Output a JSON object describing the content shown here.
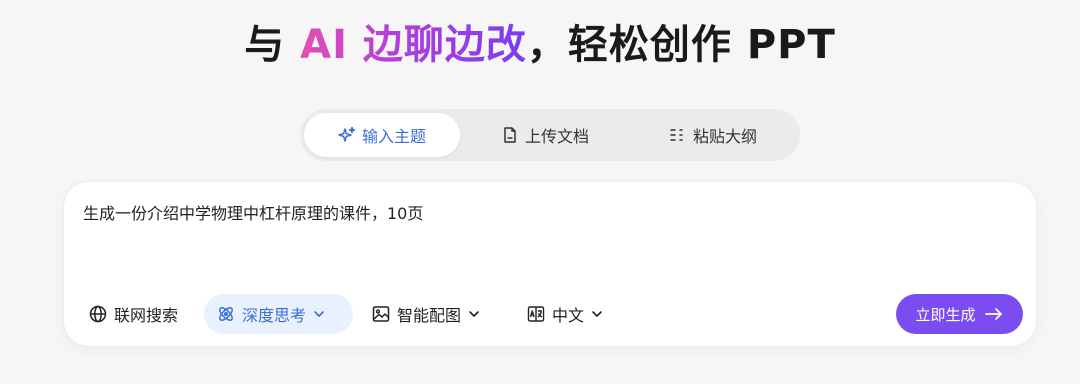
{
  "header": {
    "title_prefix": "与 ",
    "title_highlight": "AI 边聊边改",
    "title_suffix": "，轻松创作 PPT"
  },
  "mode_tabs": [
    {
      "label": "输入主题",
      "icon": "sparkle-icon",
      "active": true
    },
    {
      "label": "上传文档",
      "icon": "document-icon",
      "active": false
    },
    {
      "label": "粘贴大纲",
      "icon": "outline-list-icon",
      "active": false
    }
  ],
  "prompt": {
    "value": "生成一份介绍中学物理中杠杆原理的课件，10页"
  },
  "options": {
    "web_search": {
      "label": "联网搜索",
      "icon": "globe-icon"
    },
    "deep_think": {
      "label": "深度思考",
      "icon": "deep-think-icon",
      "active": true
    },
    "image": {
      "label": "智能配图",
      "icon": "image-icon"
    },
    "language": {
      "label": "中文",
      "icon": "translate-icon"
    }
  },
  "generate_button": {
    "label": "立即生成",
    "icon": "arrow-right-icon"
  },
  "colors": {
    "accent_purple": "#7b4df0",
    "accent_blue": "#3a6fd8",
    "highlight_gradient_start": "#e24fb0",
    "highlight_gradient_end": "#7a3df0"
  }
}
